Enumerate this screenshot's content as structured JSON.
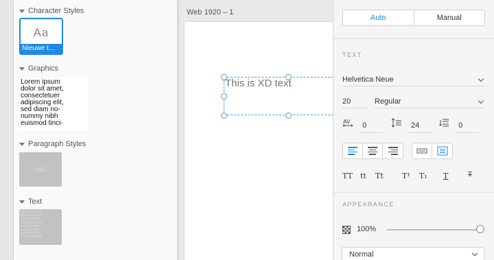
{
  "assets": {
    "character_styles": {
      "heading": "Character Styles",
      "card_preview": "Aa",
      "card_label": "Nieuwe t..."
    },
    "graphics": {
      "heading": "Graphics",
      "text_lines": [
        "Lorem ipsum",
        "dolor sit amet,",
        "consectetuer",
        "adipiscing elit,",
        "sed diam no-",
        "nummy nibh",
        "euismod tinci-"
      ]
    },
    "paragraph_styles": {
      "heading": "Paragraph Styles"
    },
    "text": {
      "heading": "Text",
      "thumb_lines": [
        "Lorem ipsum",
        "dolor sit amet,",
        "consectetuer",
        "adipiscing elit,",
        "sed diam no-",
        "nummy nibh",
        "euismod tinci-",
        "dunt ut laoreet"
      ]
    }
  },
  "canvas": {
    "artboard_title": "Web 1920 – 1",
    "text_content": "This is XD text"
  },
  "inspector": {
    "sizing": {
      "auto_label": "Auto",
      "manual_label": "Manual",
      "selected": "Auto"
    },
    "text_section": {
      "title": "TEXT",
      "font_family": "Helvetica Neue",
      "font_size": "20",
      "font_weight": "Regular",
      "char_spacing": "0",
      "line_spacing": "24",
      "paragraph_spacing": "0",
      "alignment_selected": "left",
      "box_type_selected": "area",
      "style_labels": [
        "TT",
        "tt",
        "Tt",
        "T¹",
        "T₁",
        "T",
        "T"
      ]
    },
    "appearance": {
      "title": "APPEARANCE",
      "opacity": "100%",
      "opacity_value": 1.0,
      "blend_mode": "Normal"
    }
  },
  "colors": {
    "accent": "#1a8ae6",
    "selection": "#3f9fd6"
  }
}
